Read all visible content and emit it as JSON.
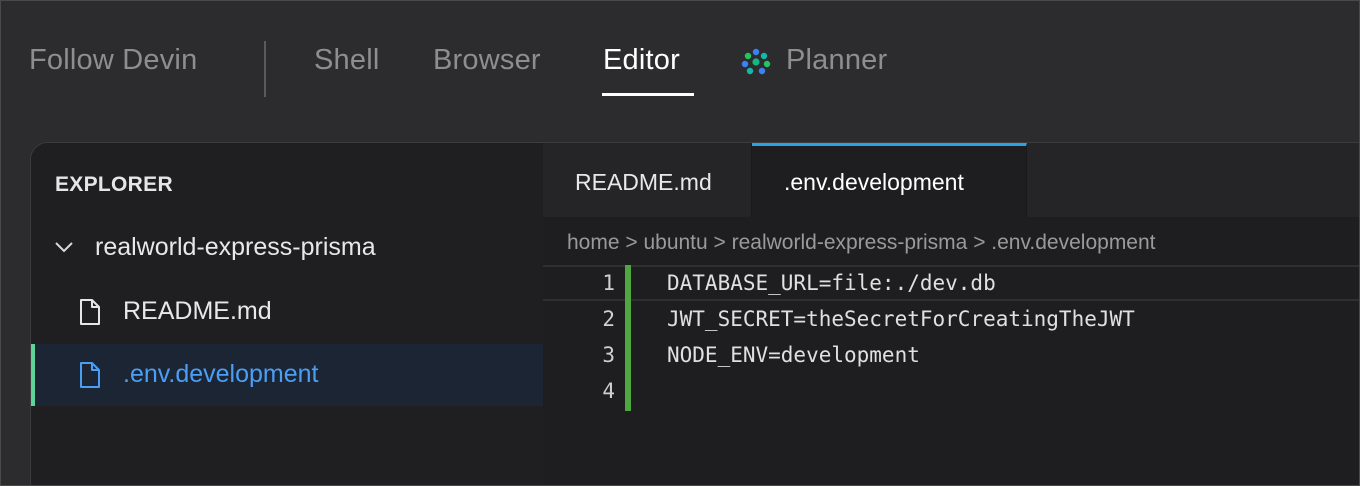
{
  "nav": {
    "follow": "Follow Devin",
    "shell": "Shell",
    "browser": "Browser",
    "editor": "Editor",
    "planner": "Planner"
  },
  "explorer": {
    "title": "EXPLORER",
    "folder": "realworld-express-prisma",
    "files": [
      "README.md",
      ".env.development"
    ],
    "selected_file": ".env.development"
  },
  "tabs": [
    {
      "label": "README.md",
      "active": false
    },
    {
      "label": ".env.development",
      "active": true
    }
  ],
  "breadcrumb": "home > ubuntu > realworld-express-prisma > .env.development",
  "code": {
    "lines": [
      {
        "num": "1",
        "text": "DATABASE_URL=file:./dev.db"
      },
      {
        "num": "2",
        "text": "JWT_SECRET=theSecretForCreatingTheJWT"
      },
      {
        "num": "3",
        "text": "NODE_ENV=development"
      },
      {
        "num": "4",
        "text": ""
      }
    ],
    "current_line": 1
  },
  "colors": {
    "accent_tab": "#2aa2e6",
    "selected_file": "#4a9ff5",
    "gutter_added": "#4fa83f",
    "selection_bar": "#5fd49a"
  }
}
